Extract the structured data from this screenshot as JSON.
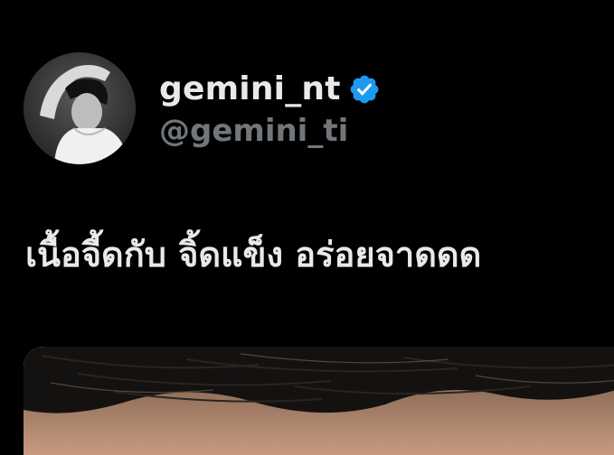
{
  "tweet": {
    "author": {
      "display_name": "gemini_nt",
      "handle": "@gemini_ti",
      "verified": true,
      "verified_icon": "verified-badge-icon",
      "avatar": "profile-photo"
    },
    "text": "เนื้อจี้ดกับ จิ้ดแข็ง อร่อยจาดดด",
    "media": "attached-photo"
  },
  "colors": {
    "background": "#000000",
    "primary_text": "#e7e9ea",
    "secondary_text": "#71767b",
    "verified_blue": "#1d9bf0"
  }
}
